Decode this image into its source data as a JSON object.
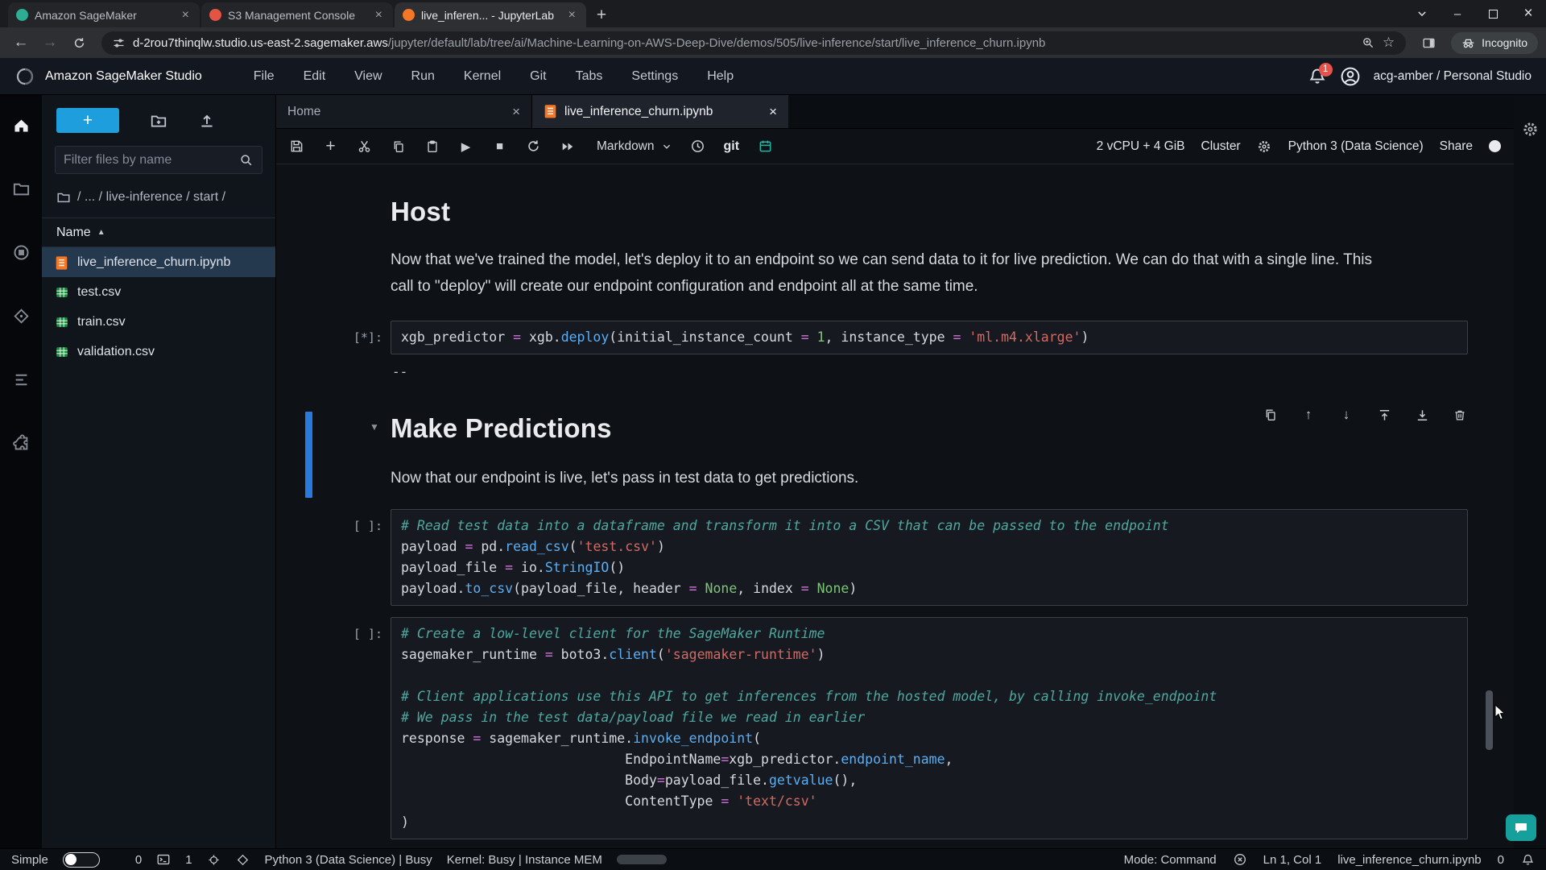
{
  "colors": {
    "accent_blue": "#2a7ade",
    "jupyter_orange": "#f37726",
    "csv_green": "#1b8a3f",
    "teal": "#15a09b",
    "new_button_blue": "#1f9ede",
    "notification_red": "#e5534b"
  },
  "browser": {
    "tabs": [
      {
        "title": "Amazon SageMaker",
        "icon": "sagemaker",
        "active": false
      },
      {
        "title": "S3 Management Console",
        "icon": "s3",
        "active": false
      },
      {
        "title": "live_inferen... - JupyterLab",
        "icon": "jupyter",
        "active": true
      }
    ],
    "url_domain": "d-2rou7thinqlw.studio.us-east-2.sagemaker.aws",
    "url_path": "/jupyter/default/lab/tree/ai/Machine-Learning-on-AWS-Deep-Dive/demos/505/live-inference/start/live_inference_churn.ipynb",
    "incognito_label": "Incognito"
  },
  "studio_header": {
    "title": "Amazon SageMaker Studio",
    "menus": [
      "File",
      "Edit",
      "View",
      "Run",
      "Kernel",
      "Git",
      "Tabs",
      "Settings",
      "Help"
    ],
    "notification_badge": "1",
    "account": "acg-amber / Personal Studio"
  },
  "sidebar": {
    "filter_placeholder": "Filter files by name",
    "breadcrumb": "/ ... / live-inference / start /",
    "name_header": "Name",
    "files": [
      {
        "name": "live_inference_churn.ipynb",
        "type": "notebook",
        "selected": true
      },
      {
        "name": "test.csv",
        "type": "csv",
        "selected": false
      },
      {
        "name": "train.csv",
        "type": "csv",
        "selected": false
      },
      {
        "name": "validation.csv",
        "type": "csv",
        "selected": false
      }
    ]
  },
  "doc_tabs": [
    {
      "title": "Home"
    },
    {
      "title": "live_inference_churn.ipynb"
    }
  ],
  "toolbar": {
    "cell_type": "Markdown",
    "git": "git",
    "resources": "2 vCPU + 4 GiB",
    "cluster": "Cluster",
    "kernel_name": "Python 3 (Data Science)",
    "share": "Share"
  },
  "cell_toolbar_icons": [
    "duplicate-icon",
    "move-up-icon",
    "move-down-icon",
    "insert-above-icon",
    "insert-below-icon",
    "delete-icon"
  ],
  "notebook": {
    "cells": [
      {
        "kind": "markdown",
        "name": "host",
        "row_class": "row-m1",
        "heading": "Host",
        "paragraph": "Now that we've trained the model, let's deploy it to an endpoint so we can send data to it for live prediction. We can do that with a single line. This call to \"deploy\" will create our endpoint configuration and endpoint all at the same time."
      },
      {
        "kind": "code",
        "name": "deploy-cell",
        "row_class": "row-c1",
        "prompt": "[*]:",
        "output": "--",
        "lines": [
          [
            [
              "xgb_predictor ",
              "v"
            ],
            [
              "=",
              "o"
            ],
            [
              " xgb.",
              "v"
            ],
            [
              "deploy",
              "f"
            ],
            [
              "(initial_instance_count ",
              "v"
            ],
            [
              "=",
              "o"
            ],
            [
              " ",
              "v"
            ],
            [
              "1",
              "n"
            ],
            [
              ", instance_type ",
              "v"
            ],
            [
              "=",
              "o"
            ],
            [
              " ",
              "v"
            ],
            [
              "'ml.m4.xlarge'",
              "s"
            ],
            [
              ")",
              "v"
            ]
          ]
        ]
      },
      {
        "kind": "markdown",
        "name": "make-predictions",
        "row_class": "row-m2",
        "selected": true,
        "collapser": true,
        "toolbar": true,
        "heading": "Make Predictions",
        "paragraph": "Now that our endpoint is live, let's pass in test data to get predictions."
      },
      {
        "kind": "code",
        "name": "payload-cell",
        "row_class": "row-c2",
        "prompt": "[ ]:",
        "lines": [
          [
            [
              "# Read test data into a dataframe and transform it into a CSV that can be passed to the endpoint",
              "c"
            ]
          ],
          [
            [
              "payload ",
              "v"
            ],
            [
              "=",
              "o"
            ],
            [
              " pd.",
              "v"
            ],
            [
              "read_csv",
              "f"
            ],
            [
              "(",
              "v"
            ],
            [
              "'test.csv'",
              "s"
            ],
            [
              ")",
              "v"
            ]
          ],
          [
            [
              "payload_file ",
              "v"
            ],
            [
              "=",
              "o"
            ],
            [
              " io.",
              "v"
            ],
            [
              "StringIO",
              "f"
            ],
            [
              "()",
              "v"
            ]
          ],
          [
            [
              "payload.",
              "v"
            ],
            [
              "to_csv",
              "f"
            ],
            [
              "(payload_file, header ",
              "v"
            ],
            [
              "=",
              "o"
            ],
            [
              " ",
              "v"
            ],
            [
              "None",
              "n"
            ],
            [
              ", index ",
              "v"
            ],
            [
              "=",
              "o"
            ],
            [
              " ",
              "v"
            ],
            [
              "None",
              "n"
            ],
            [
              ")",
              "v"
            ]
          ]
        ]
      },
      {
        "kind": "code",
        "name": "invoke-cell",
        "row_class": "row-c3",
        "prompt": "[ ]:",
        "lines": [
          [
            [
              "# Create a low-level client for the SageMaker Runtime",
              "c"
            ]
          ],
          [
            [
              "sagemaker_runtime ",
              "v"
            ],
            [
              "=",
              "o"
            ],
            [
              " boto3.",
              "v"
            ],
            [
              "client",
              "f"
            ],
            [
              "(",
              "v"
            ],
            [
              "'sagemaker-runtime'",
              "s"
            ],
            [
              ")",
              "v"
            ]
          ],
          [],
          [
            [
              "# Client applications use this API to get inferences from the hosted model, by calling invoke_endpoint",
              "c"
            ]
          ],
          [
            [
              "# We pass in the test data/payload file we read in earlier",
              "c"
            ]
          ],
          [
            [
              "response ",
              "v"
            ],
            [
              "=",
              "o"
            ],
            [
              " sagemaker_runtime.",
              "v"
            ],
            [
              "invoke_endpoint",
              "f"
            ],
            [
              "(",
              "v"
            ]
          ],
          [
            [
              "                            EndpointName",
              "v"
            ],
            [
              "=",
              "o"
            ],
            [
              "xgb_predictor.",
              "v"
            ],
            [
              "endpoint_name",
              "f"
            ],
            [
              ",",
              "v"
            ]
          ],
          [
            [
              "                            Body",
              "v"
            ],
            [
              "=",
              "o"
            ],
            [
              "payload_file.",
              "v"
            ],
            [
              "getvalue",
              "f"
            ],
            [
              "(),",
              "v"
            ]
          ],
          [
            [
              "                            ContentType ",
              "v"
            ],
            [
              "=",
              "o"
            ],
            [
              " ",
              "v"
            ],
            [
              "'text/csv'",
              "s"
            ]
          ],
          [
            [
              ")",
              "v"
            ]
          ]
        ]
      }
    ]
  },
  "status_bar": {
    "simple_label": "Simple",
    "terminals": "0",
    "kernels": "1",
    "kernel_status": "Python 3 (Data Science) | Busy",
    "memory_label": "Kernel: Busy | Instance MEM",
    "mode": "Mode: Command",
    "cursor_position": "Ln 1, Col 1",
    "file_name": "live_inference_churn.ipynb",
    "notifications": "0"
  }
}
